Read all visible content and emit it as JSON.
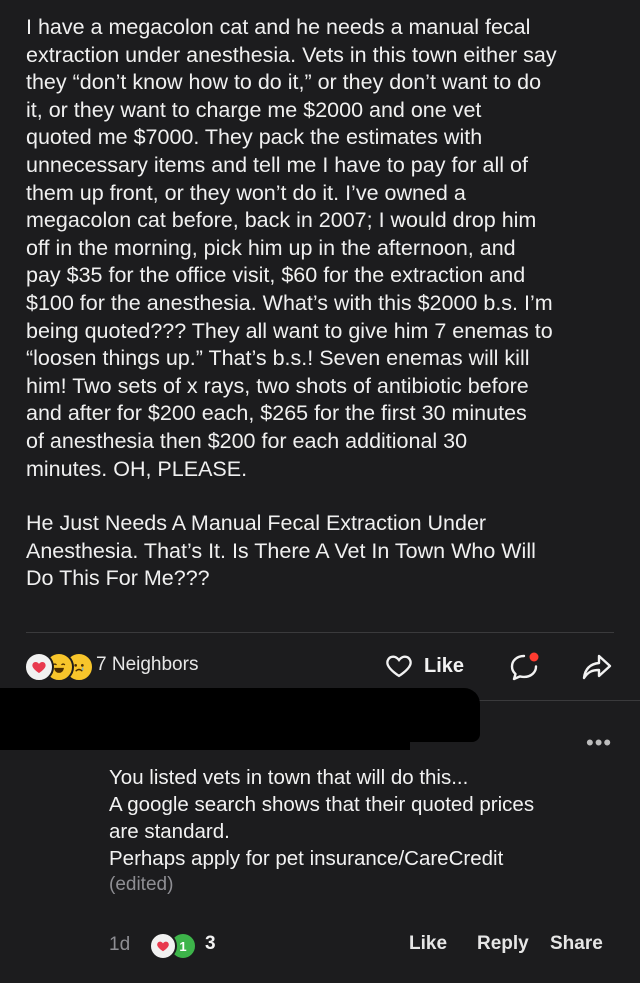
{
  "post": {
    "paragraphs": [
      [
        "I have a megacolon cat and he needs a manual fecal",
        "extraction under anesthesia. Vets in this town either say",
        "they “don’t know how to do it,” or they don’t want to do",
        "it, or they want to charge me $2000 and one vet",
        "quoted me $7000. They pack the estimates with",
        "unnecessary items and tell me I have to pay for all of",
        "them up front, or they won’t do it. I’ve owned a",
        "megacolon cat before, back in 2007; I would drop him",
        "off in the morning, pick him up in the afternoon, and",
        "pay $35 for the office visit, $60 for the extraction and",
        "$100 for the anesthesia. What’s with this $2000 b.s. I’m",
        "being quoted??? They all want to give him 7 enemas to",
        "“loosen things up.” That’s b.s.! Seven enemas will kill",
        "him! Two sets of x rays, two shots of antibiotic before",
        "and after for $200 each, $265 for the first 30 minutes",
        "of anesthesia then $200 for each additional 30",
        "minutes. OH, PLEASE."
      ],
      [
        "He Just Needs A Manual Fecal Extraction Under",
        "Anesthesia. That’s It. Is There A Vet In Town Who Will",
        "Do This For Me???"
      ]
    ],
    "reaction_count_label": "7 Neighbors",
    "like_label": "Like",
    "reaction_icons": [
      "heart-icon",
      "laughing-face-icon",
      "sad-face-icon"
    ]
  },
  "comment": {
    "more_label": "•••",
    "lines": [
      "You listed vets in town that will do this...",
      "A google search shows that their quoted prices",
      "are standard.",
      "Perhaps apply for pet insurance/CareCredit"
    ],
    "edited_label": "(edited)",
    "time": "1d",
    "reaction_badge": "1",
    "reaction_count": "3",
    "like_label": "Like",
    "reply_label": "Reply",
    "share_label": "Share"
  },
  "colors": {
    "background": "#1c1c1e",
    "text": "#f2f2f2",
    "muted": "#8e8e93",
    "notification_dot": "#ff3b30"
  }
}
